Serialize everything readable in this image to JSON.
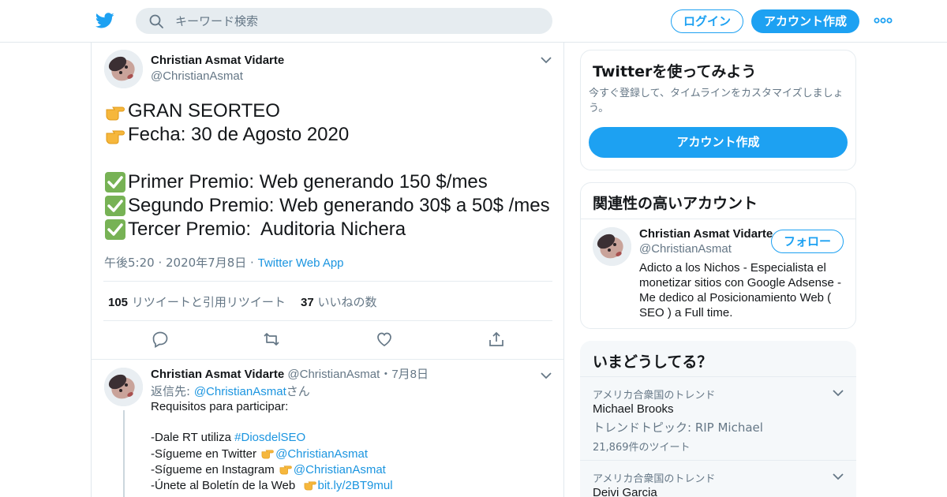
{
  "header": {
    "logo_icon": "twitter-bird-icon",
    "search_placeholder": "キーワード検索",
    "login_label": "ログイン",
    "signup_label": "アカウント作成",
    "more_icon": "more-dots-icon",
    "accent_color": "#1da1f2"
  },
  "tweet": {
    "author_name": "Christian Asmat Vidarte",
    "author_handle": "@ChristianAsmat",
    "lines": [
      {
        "emoji": "pointing-right",
        "text": "GRAN SEORTEO"
      },
      {
        "emoji": "pointing-right",
        "text": "Fecha: 30 de Agosto 2020"
      },
      {
        "emoji": "",
        "text": ""
      },
      {
        "emoji": "check-mark",
        "text": "Primer Premio: Web generando 150 $/mes"
      },
      {
        "emoji": "check-mark",
        "text": "Segundo Premio: Web generando 30$ a 50$ /mes"
      },
      {
        "emoji": "check-mark",
        "text": "Tercer Premio:  Auditoria Nichera"
      }
    ],
    "time": "午後5:20",
    "date": "2020年7月8日",
    "source": "Twitter Web App",
    "retweet_count": "105",
    "retweet_label": "リツイートと引用リツイート",
    "like_count": "37",
    "like_label": "いいねの数"
  },
  "reply": {
    "author_name": "Christian Asmat Vidarte",
    "author_handle": "@ChristianAsmat",
    "date": "7月8日",
    "reply_to_prefix": "返信先: ",
    "reply_to_handle": "@ChristianAsmat",
    "reply_to_suffix": "さん",
    "line1": "Requisitos para participar:",
    "line2_text": "-Dale RT utiliza ",
    "line2_tag": "#DiosdelSEO",
    "line3_text": "-Sígueme en Twitter ",
    "line3_link": "@ChristianAsmat",
    "line4_text": "-Sígueme en Instagram ",
    "line4_link": "@ChristianAsmat",
    "line5_text": "-Únete al Boletín de la Web  ",
    "line5_link": "bit.ly/2BT9mul"
  },
  "signup_card": {
    "title": "Twitterを使ってみよう",
    "description_line1": "今すぐ登録して、タイムラインをカスタマイズしましょ",
    "description_line2": "う。",
    "button_label": "アカウント作成"
  },
  "related_card": {
    "title": "関連性の高いアカウント",
    "name": "Christian Asmat Vidarte",
    "handle": "@ChristianAsmat",
    "follow_label": "フォロー",
    "bio_lines": [
      "Adicto a los Nichos - Especialista el",
      "monetizar sitios con Google Adsense -",
      "Me dedico al Posicionamiento Web (",
      "SEO ) a Full time."
    ]
  },
  "trends": {
    "title": "いまどうしてる？",
    "items": [
      {
        "context": "アメリカ合衆国のトレンド",
        "name": "Michael Brooks",
        "topic": "トレンドトピック: RIP Michael",
        "count": "21,869件のツイート"
      },
      {
        "context": "アメリカ合衆国のトレンド",
        "name": "Deivi Garcia",
        "topic": "",
        "count": ""
      }
    ]
  }
}
